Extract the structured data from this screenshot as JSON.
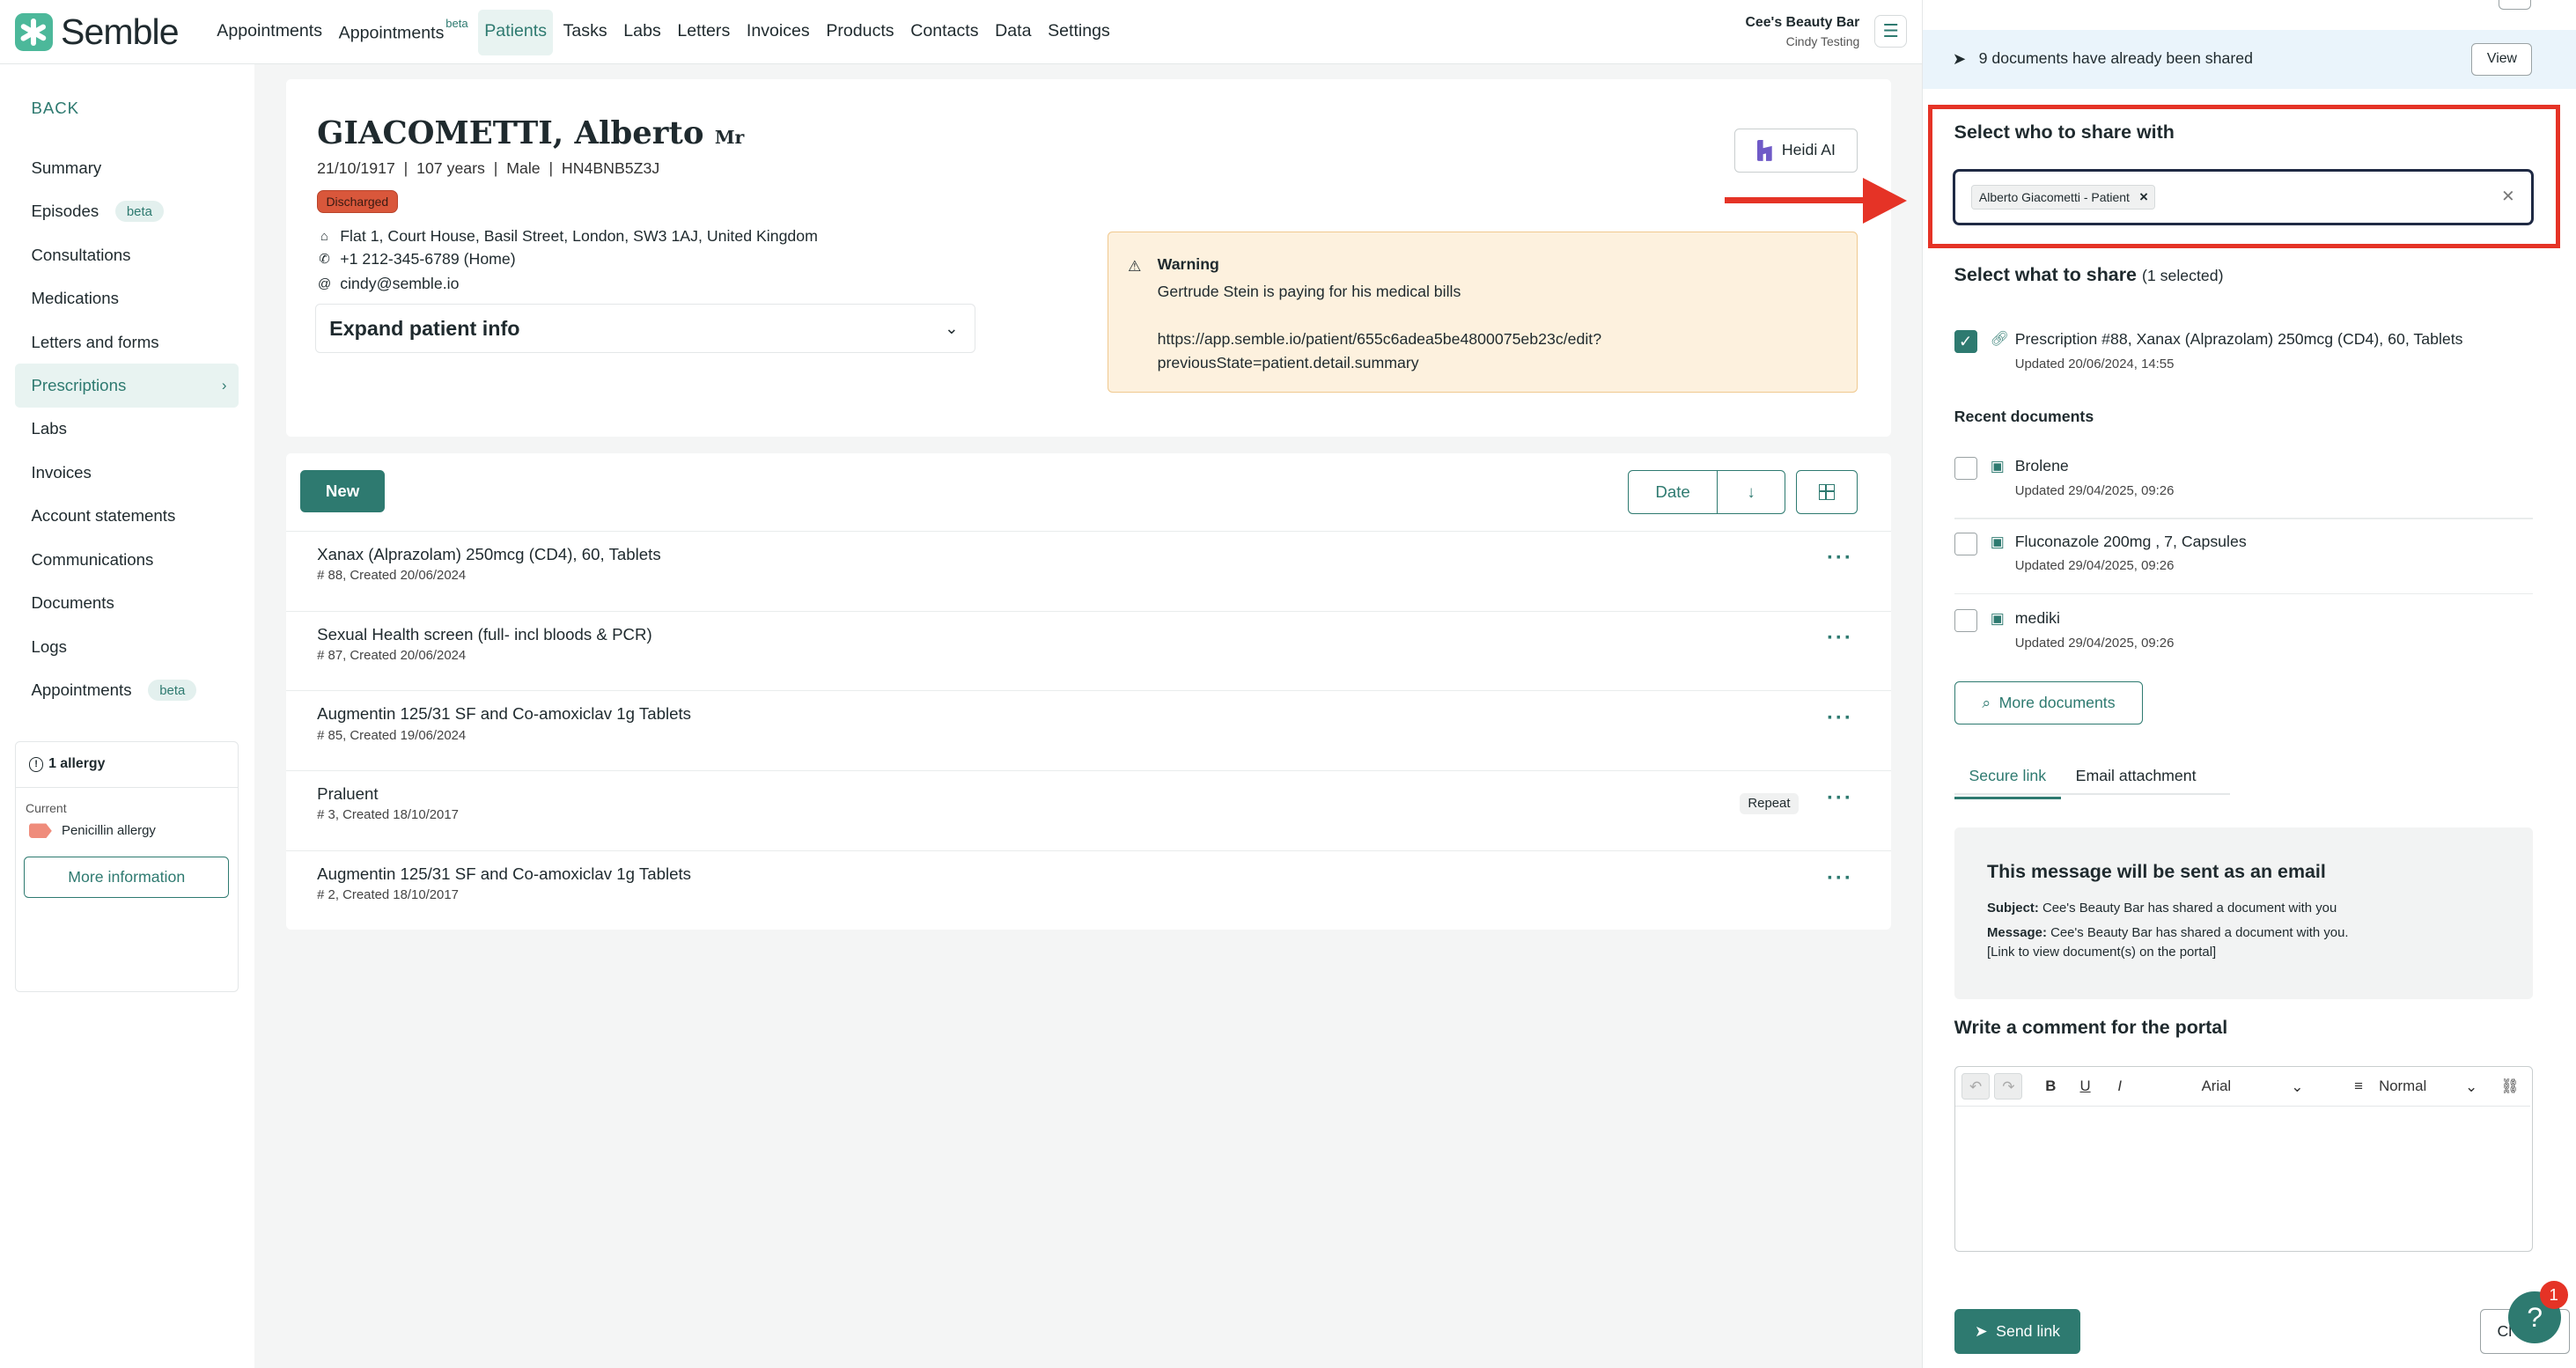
{
  "nav": {
    "logo": "Semble",
    "items": [
      {
        "label": "Appointments"
      },
      {
        "label": "Appointments",
        "badge": "beta"
      },
      {
        "label": "Patients",
        "active": true
      },
      {
        "label": "Tasks"
      },
      {
        "label": "Labs"
      },
      {
        "label": "Letters"
      },
      {
        "label": "Invoices"
      },
      {
        "label": "Products"
      },
      {
        "label": "Contacts"
      },
      {
        "label": "Data"
      },
      {
        "label": "Settings"
      }
    ],
    "org_name": "Cee's Beauty Bar",
    "org_user": "Cindy Testing"
  },
  "sidebar": {
    "back": "BACK",
    "items": [
      {
        "label": "Summary"
      },
      {
        "label": "Episodes",
        "badge": "beta"
      },
      {
        "label": "Consultations"
      },
      {
        "label": "Medications"
      },
      {
        "label": "Letters and forms"
      },
      {
        "label": "Prescriptions",
        "active": true
      },
      {
        "label": "Labs"
      },
      {
        "label": "Invoices"
      },
      {
        "label": "Account statements"
      },
      {
        "label": "Communications"
      },
      {
        "label": "Documents"
      },
      {
        "label": "Logs"
      },
      {
        "label": "Appointments",
        "badge": "beta"
      }
    ],
    "allergy": {
      "title": "1 allergy",
      "current_label": "Current",
      "item": "Penicillin allergy",
      "more_button": "More information"
    }
  },
  "patient": {
    "surname": "GIACOMETTI, Alberto",
    "title": "Mr",
    "meta": "21/10/1917  |  107 years  |  Male  |  HN4BNB5Z3J",
    "status": "Discharged",
    "address": "Flat 1, Court House, Basil Street, London, SW3 1AJ, United Kingdom",
    "phone": "+1 212-345-6789 (Home)",
    "email": "cindy@semble.io",
    "expand_label": "Expand patient info",
    "heidi_button": "Heidi AI",
    "warning_title": "Warning",
    "warning_line1": "Gertrude Stein is paying for his medical bills",
    "warning_line2": "https://app.semble.io/patient/655c6adea5be4800075eb23c/edit?",
    "warning_line3": "previousState=patient.detail.summary"
  },
  "prescriptions": {
    "new_button": "New",
    "sort_label": "Date",
    "rows": [
      {
        "name": "Xanax (Alprazolam) 250mcg (CD4), 60, Tablets",
        "sub": "# 88, Created 20/06/2024"
      },
      {
        "name": "Sexual Health screen (full- incl bloods & PCR)",
        "sub": "# 87, Created 20/06/2024"
      },
      {
        "name": "Augmentin 125/31 SF and Co-amoxiclav 1g Tablets",
        "sub": "# 85, Created 19/06/2024"
      },
      {
        "name": "Praluent",
        "sub": "# 3, Created 18/10/2017",
        "tag": "Repeat"
      },
      {
        "name": "Augmentin 125/31 SF and Co-amoxiclav 1g Tablets",
        "sub": "# 2, Created 18/10/2017"
      }
    ]
  },
  "share": {
    "shared_text": "9 documents have already been shared",
    "view_button": "View",
    "select_who": "Select who to share with",
    "recipient_chip": "Alberto Giacometti - Patient",
    "select_what": "Select what to share",
    "selected_count": "(1 selected)",
    "selected_doc": {
      "name": "Prescription #88, Xanax (Alprazolam) 250mcg (CD4), 60, Tablets",
      "updated": "Updated 20/06/2024, 14:55"
    },
    "recent_title": "Recent documents",
    "recent": [
      {
        "name": "Brolene",
        "updated": "Updated 29/04/2025, 09:26"
      },
      {
        "name": "Fluconazole 200mg , 7, Capsules",
        "updated": "Updated 29/04/2025, 09:26"
      },
      {
        "name": "mediki",
        "updated": "Updated 29/04/2025, 09:26"
      }
    ],
    "more_docs_button": "More documents",
    "tabs": [
      "Secure link",
      "Email attachment"
    ],
    "message_title": "This message will be sent as an email",
    "subject_label": "Subject:",
    "subject_text": "Cee's Beauty Bar has shared a document with you",
    "message_label": "Message:",
    "message_text": "Cee's Beauty Bar has shared a document with you.",
    "message_link": "[Link to view document(s) on the portal]",
    "comment_title": "Write a comment for the portal",
    "editor_font": "Arial",
    "editor_style": "Normal",
    "send_button": "Send link",
    "close_button": "Cl",
    "help_badge": "1"
  }
}
